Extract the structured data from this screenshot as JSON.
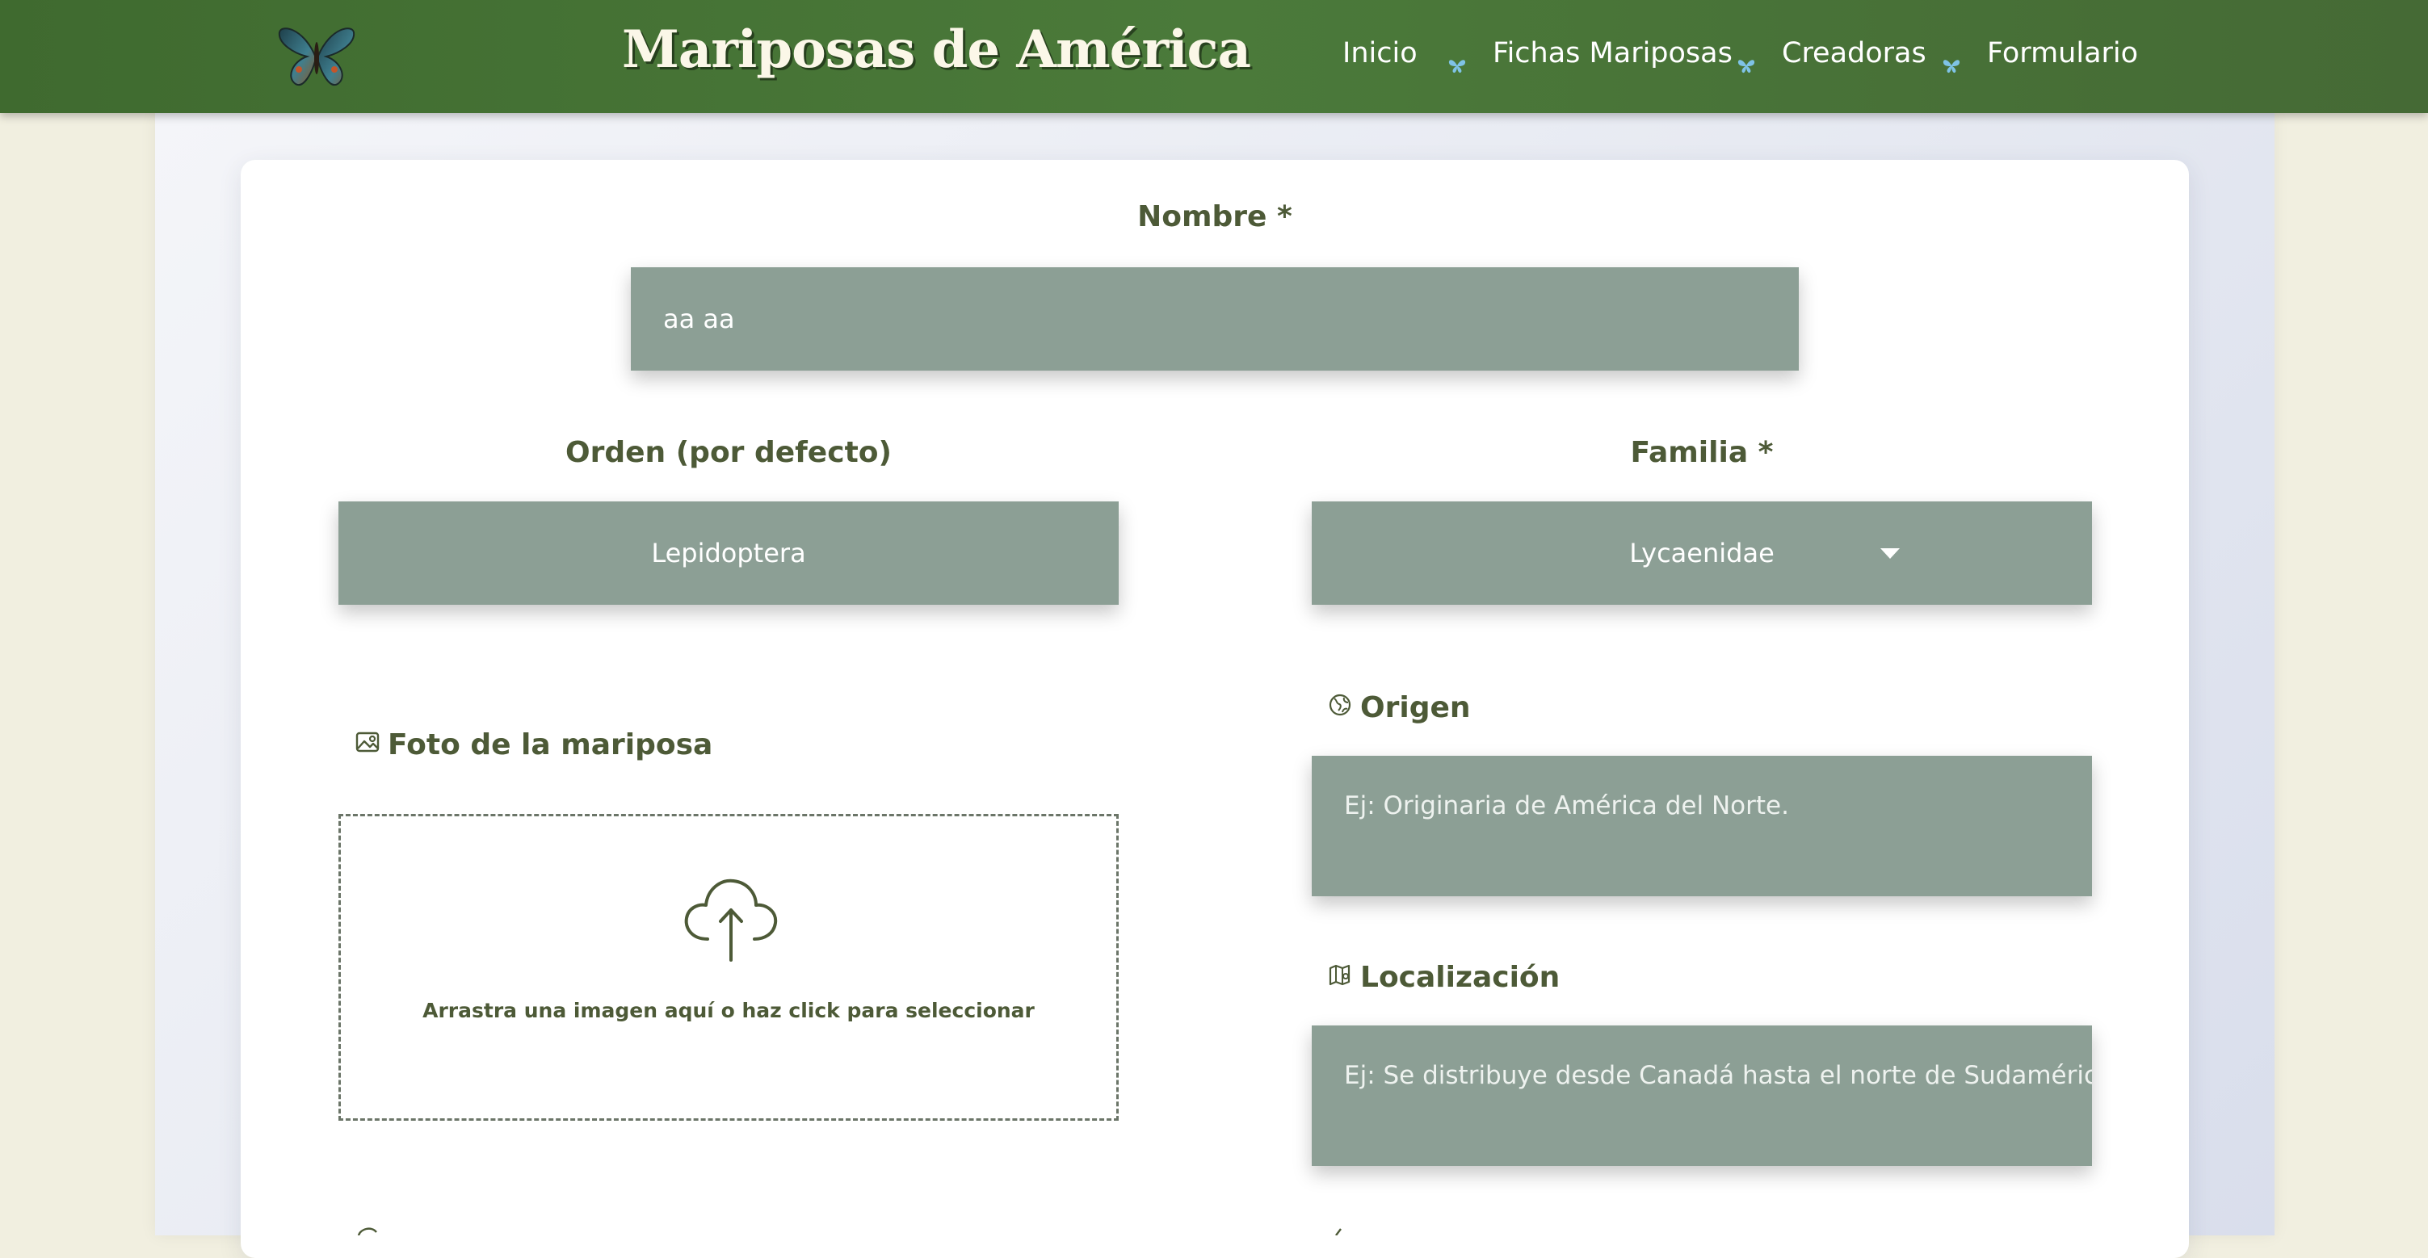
{
  "header": {
    "brand": "Mariposas de América",
    "nav": [
      {
        "label": "Inicio"
      },
      {
        "label": "Fichas Mariposas"
      },
      {
        "label": "Creadoras"
      },
      {
        "label": "Formulario"
      }
    ]
  },
  "form": {
    "nombre": {
      "label": "Nombre *",
      "value": "aa aa"
    },
    "orden": {
      "label": "Orden (por defecto)",
      "value": "Lepidoptera"
    },
    "familia": {
      "label": "Familia *",
      "selected": "Lycaenidae"
    },
    "foto": {
      "label": "Foto de la mariposa",
      "drop_text": "Arrastra una imagen aquí o haz click para seleccionar"
    },
    "origen": {
      "label": "Origen",
      "placeholder": "Ej: Originaria de América del Norte."
    },
    "localizacion": {
      "label": "Localización",
      "placeholder": "Ej: Se distribuye desde Canadá hasta el norte de Sudamérica."
    }
  },
  "colors": {
    "header_green": "#4b7a3a",
    "field_sage": "#8c9f95",
    "label_olive": "#4d5a37",
    "page_cream": "#f1efe0"
  },
  "icons": [
    "butterfly-logo-icon",
    "butterfly-divider-icon",
    "image-icon",
    "upload-cloud-icon",
    "globe-icon",
    "map-icon",
    "chevron-down-icon"
  ]
}
